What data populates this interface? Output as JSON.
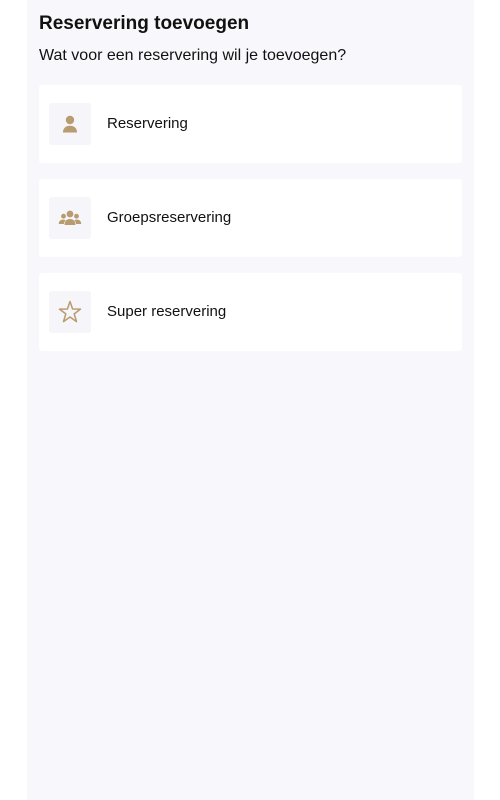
{
  "header": {
    "title": "Reservering toevoegen",
    "subtitle": "Wat voor een reservering wil je toevoegen?"
  },
  "options": [
    {
      "label": "Reservering",
      "icon": "person-icon"
    },
    {
      "label": "Groepsreservering",
      "icon": "group-icon"
    },
    {
      "label": "Super reservering",
      "icon": "star-icon"
    }
  ],
  "colors": {
    "accent": "#b89b6f",
    "panel_background": "#f8f8fc",
    "card_background": "#ffffff"
  }
}
